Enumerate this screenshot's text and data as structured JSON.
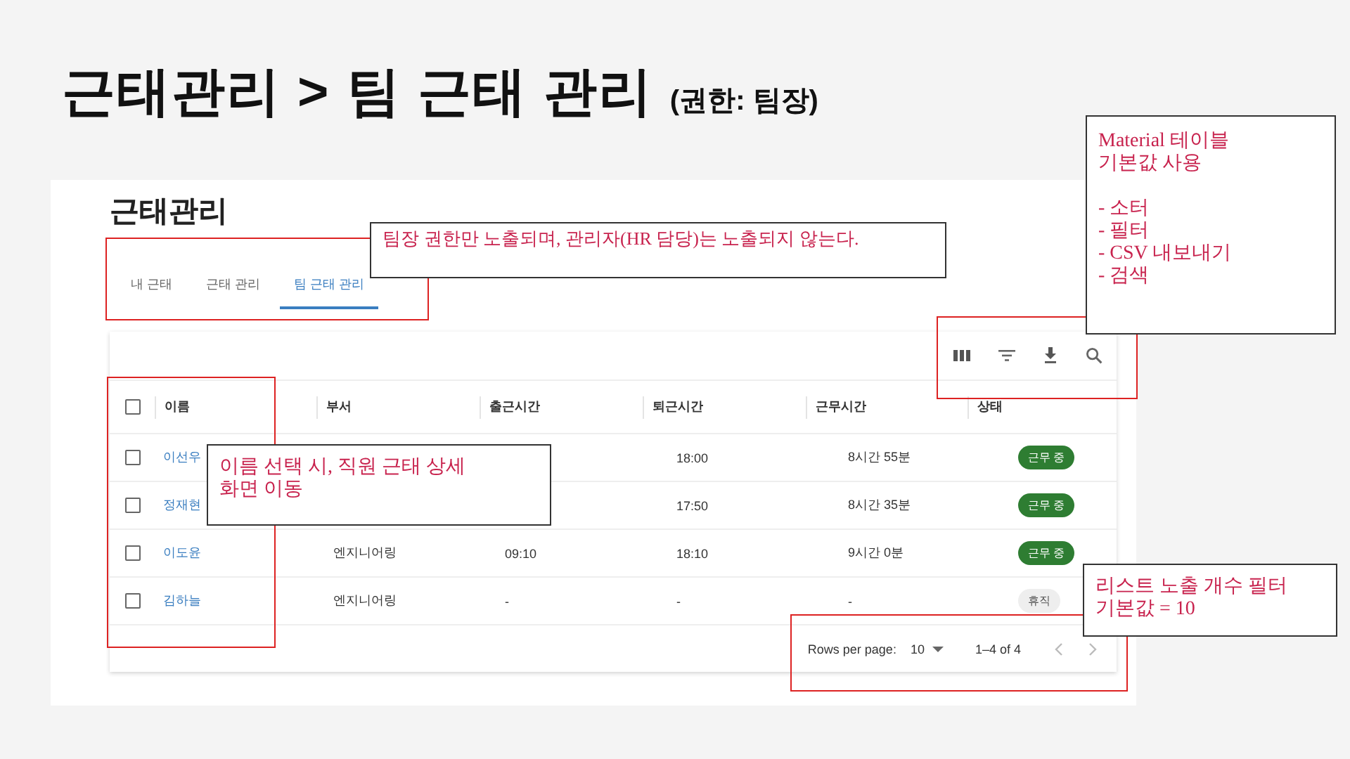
{
  "slide_title": {
    "main": "근태관리 > 팀 근태 관리",
    "note": "(권한: 팀장)"
  },
  "page": {
    "heading": "근태관리"
  },
  "tabs": [
    {
      "label": "내 근태",
      "selected": false
    },
    {
      "label": "근태 관리",
      "selected": false
    },
    {
      "label": "팀 근태 관리",
      "selected": true
    }
  ],
  "table": {
    "select_all": {
      "checked": false
    },
    "columns": [
      "이름",
      "부서",
      "출근시간",
      "퇴근시간",
      "근무시간",
      "상태"
    ],
    "rows": [
      {
        "checked": false,
        "cells": [
          "이선우",
          "",
          "",
          "18:00",
          "8시간 55분"
        ],
        "status": {
          "label": "근무 중",
          "kind": "working"
        }
      },
      {
        "checked": false,
        "cells": [
          "정재현",
          "",
          "",
          "17:50",
          "8시간 35분"
        ],
        "status": {
          "label": "근무 중",
          "kind": "working"
        }
      },
      {
        "checked": false,
        "cells": [
          "이도윤",
          "엔지니어링",
          "09:10",
          "18:10",
          "9시간 0분"
        ],
        "status": {
          "label": "근무 중",
          "kind": "working"
        }
      },
      {
        "checked": false,
        "cells": [
          "김하늘",
          "엔지니어링",
          "-",
          "-",
          "-"
        ],
        "status": {
          "label": "휴직",
          "kind": "leave"
        }
      }
    ],
    "pagination": {
      "rows_label": "Rows per page:",
      "rows_value": "10",
      "range": "1–4 of 4"
    }
  },
  "annotations": [
    {
      "paragraphs": [
        [
          "팀장 권한만 노출되며, 관리자(HR 담당)는 노출되지 않는다."
        ]
      ]
    },
    {
      "paragraphs": [
        [
          "Material 테이블",
          "기본값 사용"
        ],
        [
          "- 소터",
          "- 필터",
          "- CSV 내보내기",
          "- 검색"
        ]
      ]
    },
    {
      "paragraphs": [
        [
          "이름 선택 시, 직원 근태 상세",
          "화면 이동"
        ]
      ]
    },
    {
      "paragraphs": [
        [
          "리스트 노출 개수 필터",
          "기본값 = 10"
        ]
      ]
    }
  ]
}
